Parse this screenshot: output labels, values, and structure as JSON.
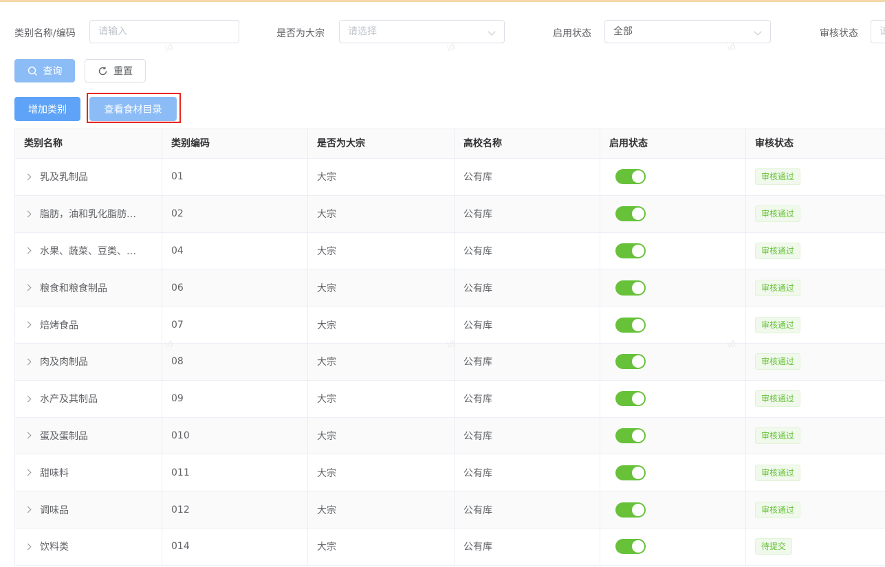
{
  "filters": {
    "category_label": "类别名称/编码",
    "category_placeholder": "请输入",
    "bulk_label": "是否为大宗",
    "bulk_placeholder": "请选择",
    "enable_label": "启用状态",
    "enable_value": "全部",
    "audit_label": "审核状态",
    "audit_placeholder": "请"
  },
  "actions": {
    "query": "查询",
    "reset": "重置",
    "add_category": "增加类别",
    "view_catalog": "查看食材目录"
  },
  "table": {
    "headers": [
      "类别名称",
      "类别编码",
      "是否为大宗",
      "高校名称",
      "启用状态",
      "审核状态"
    ],
    "rows": [
      {
        "name": "乳及乳制品",
        "code": "01",
        "bulk": "大宗",
        "school": "公有库",
        "enabled": true,
        "audit": "审核通过"
      },
      {
        "name": "脂肪，油和乳化脂肪…",
        "code": "02",
        "bulk": "大宗",
        "school": "公有库",
        "enabled": true,
        "audit": "审核通过"
      },
      {
        "name": "水果、蔬菜、豆类、…",
        "code": "04",
        "bulk": "大宗",
        "school": "公有库",
        "enabled": true,
        "audit": "审核通过"
      },
      {
        "name": "粮食和粮食制品",
        "code": "06",
        "bulk": "大宗",
        "school": "公有库",
        "enabled": true,
        "audit": "审核通过"
      },
      {
        "name": "焙烤食品",
        "code": "07",
        "bulk": "大宗",
        "school": "公有库",
        "enabled": true,
        "audit": "审核通过"
      },
      {
        "name": "肉及肉制品",
        "code": "08",
        "bulk": "大宗",
        "school": "公有库",
        "enabled": true,
        "audit": "审核通过"
      },
      {
        "name": "水产及其制品",
        "code": "09",
        "bulk": "大宗",
        "school": "公有库",
        "enabled": true,
        "audit": "审核通过"
      },
      {
        "name": "蛋及蛋制品",
        "code": "010",
        "bulk": "大宗",
        "school": "公有库",
        "enabled": true,
        "audit": "审核通过"
      },
      {
        "name": "甜味料",
        "code": "011",
        "bulk": "大宗",
        "school": "公有库",
        "enabled": true,
        "audit": "审核通过"
      },
      {
        "name": "调味品",
        "code": "012",
        "bulk": "大宗",
        "school": "公有库",
        "enabled": true,
        "audit": "审核通过"
      },
      {
        "name": "饮料类",
        "code": "014",
        "bulk": "大宗",
        "school": "公有库",
        "enabled": true,
        "audit": "待提交"
      }
    ]
  },
  "colors": {
    "primary": "#5ea3f7",
    "primary_light": "#8cbcf6",
    "success": "#67c23a",
    "highlight": "#e8241f"
  },
  "watermark": "id"
}
